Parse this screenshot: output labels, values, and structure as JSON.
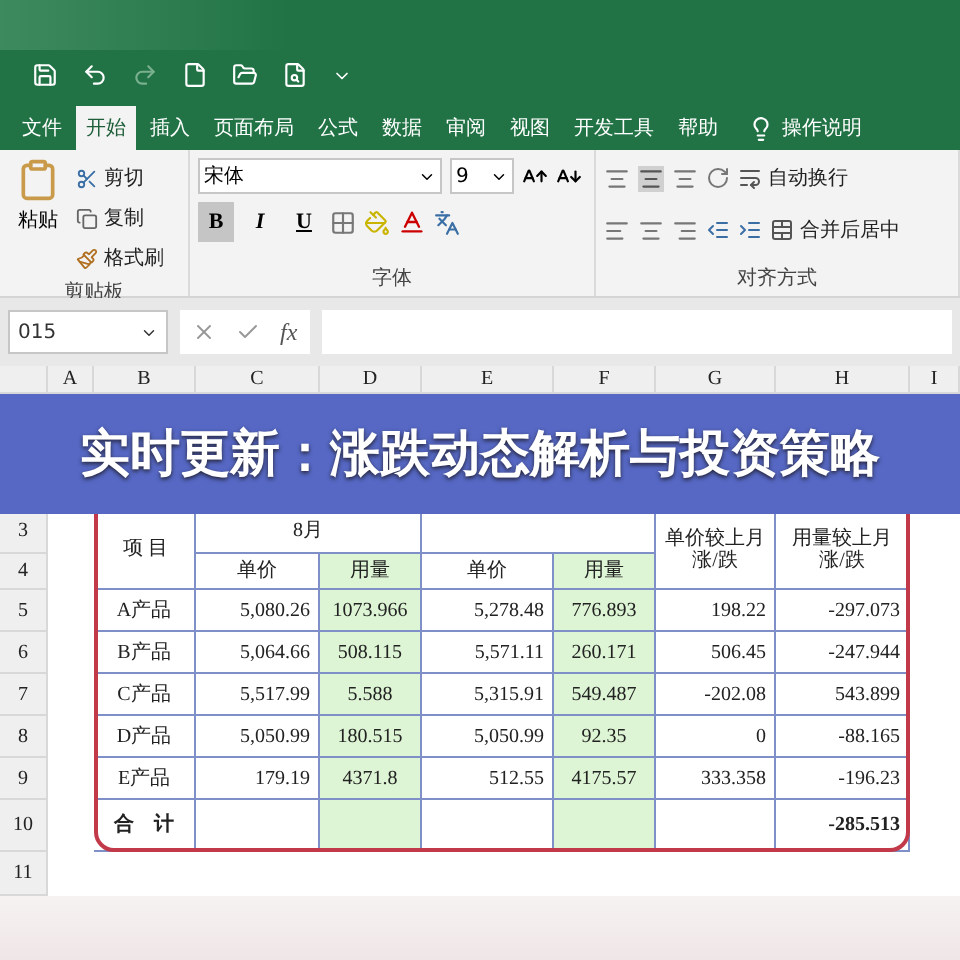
{
  "tabs": [
    {
      "label": "文件",
      "selected": false
    },
    {
      "label": "开始",
      "selected": true
    },
    {
      "label": "插入",
      "selected": false
    },
    {
      "label": "页面布局",
      "selected": false
    },
    {
      "label": "公式",
      "selected": false
    },
    {
      "label": "数据",
      "selected": false
    },
    {
      "label": "审阅",
      "selected": false
    },
    {
      "label": "视图",
      "selected": false
    },
    {
      "label": "开发工具",
      "selected": false
    },
    {
      "label": "帮助",
      "selected": false
    }
  ],
  "tell_me": "操作说明",
  "clipboard": {
    "paste": "粘贴",
    "cut": "剪切",
    "copy": "复制",
    "format_painter": "格式刷",
    "group": "剪贴板"
  },
  "font": {
    "name": "宋体",
    "size": "9",
    "bold": "B",
    "bold_on": true,
    "italic": "I",
    "underline": "U",
    "group": "字体"
  },
  "alignment": {
    "wrap": "自动换行",
    "merge": "合并后居中",
    "group": "对齐方式"
  },
  "formula_bar": {
    "name_box": "015",
    "fx": "fx"
  },
  "sheet": {
    "columns": [
      "A",
      "B",
      "C",
      "D",
      "E",
      "F",
      "G",
      "H",
      "I"
    ],
    "row_numbers": [
      "3",
      "4",
      "5",
      "6",
      "7",
      "8",
      "9",
      "10",
      "11"
    ],
    "item_header": "项 目",
    "month_header": "8月",
    "g_header": "单价较上月涨/跌",
    "h_header": "用量较上月涨/跌",
    "sub_headers": [
      {
        "label": "单价",
        "highlighted": false
      },
      {
        "label": "用量",
        "highlighted": true
      },
      {
        "label": "单价",
        "highlighted": false
      },
      {
        "label": "用量",
        "highlighted": true
      }
    ],
    "rows": [
      {
        "item": "A产品",
        "values": [
          "5,080.26",
          "1073.966",
          "5,278.48",
          "776.893",
          "198.22",
          "-297.073"
        ]
      },
      {
        "item": "B产品",
        "values": [
          "5,064.66",
          "508.115",
          "5,571.11",
          "260.171",
          "506.45",
          "-247.944"
        ]
      },
      {
        "item": "C产品",
        "values": [
          "5,517.99",
          "5.588",
          "5,315.91",
          "549.487",
          "-202.08",
          "543.899"
        ]
      },
      {
        "item": "D产品",
        "values": [
          "5,050.99",
          "180.515",
          "5,050.99",
          "92.35",
          "0",
          "-88.165"
        ]
      },
      {
        "item": "E产品",
        "values": [
          "179.19",
          "4371.8",
          "512.55",
          "4175.57",
          "333.358",
          "-196.23"
        ]
      }
    ],
    "total": {
      "label": "合　计",
      "value": "-285.513"
    }
  },
  "banner": {
    "title": "实时更新：涨跌动态解析与投资策略"
  }
}
